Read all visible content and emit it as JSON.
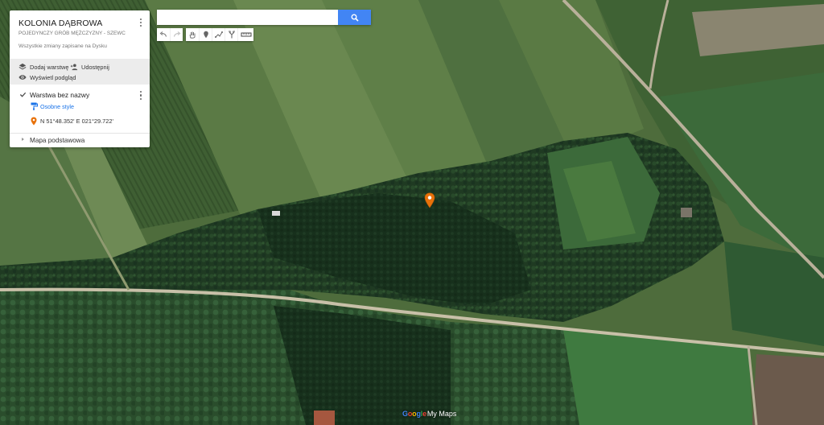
{
  "map": {
    "title": "KOLONIA DĄBROWA",
    "description": "POJEDYNCZY GRÓB MĘŻCZYZNY - SZEWC",
    "save_status": "Wszystkie zmiany zapisane na Dysku"
  },
  "actions": {
    "add_layer": "Dodaj warstwę",
    "share": "Udostępnij",
    "preview": "Wyświetl podgląd"
  },
  "layer": {
    "name": "Warstwa bez nazwy",
    "checked": true,
    "style_label": "Osobne style",
    "items": [
      {
        "label": "N 51°48.352' E 021°29.722'",
        "icon": "orange-pin-icon",
        "color": "#e8710a"
      }
    ]
  },
  "basemap": {
    "label": "Mapa podstawowa"
  },
  "search": {
    "value": "",
    "placeholder": ""
  },
  "toolbar": {
    "buttons": [
      "undo-icon",
      "redo-icon",
      "hand-icon",
      "marker-icon",
      "line-icon",
      "route-icon",
      "ruler-icon"
    ]
  },
  "colors": {
    "accent": "#4285f4",
    "marker": "#e8710a",
    "link": "#1a73e8"
  },
  "footer": {
    "logo_google": "Google",
    "logo_product": "My Maps"
  }
}
